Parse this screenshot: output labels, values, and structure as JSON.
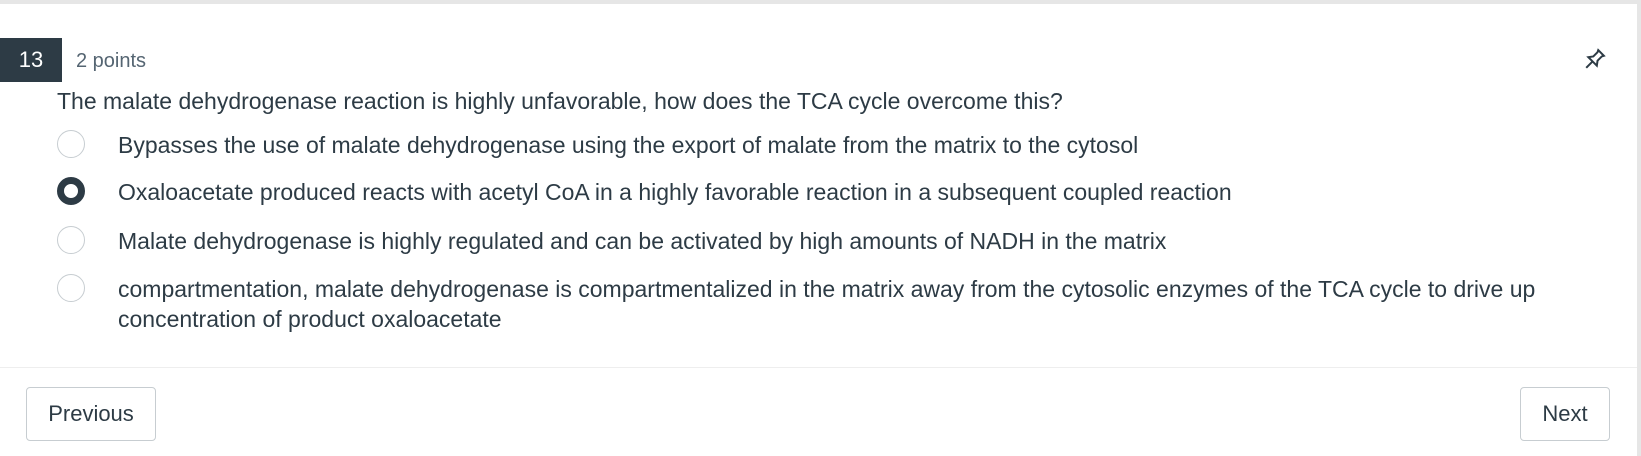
{
  "question": {
    "number": "13",
    "points": "2 points",
    "text": "The malate dehydrogenase reaction is highly unfavorable, how does the TCA cycle overcome this?",
    "pin_icon": "pin-icon",
    "answers": [
      {
        "label": "Bypasses the use of malate dehydrogenase using the export of malate from the matrix to the cytosol",
        "selected": false
      },
      {
        "label": "Oxaloacetate produced reacts with acetyl CoA in a highly favorable reaction in a subsequent coupled reaction",
        "selected": true
      },
      {
        "label": "Malate dehydrogenase is highly regulated and can be activated by high amounts of NADH in the matrix",
        "selected": false
      },
      {
        "label": "compartmentation, malate dehydrogenase is compartmentalized in the matrix away from the cytosolic enzymes of the TCA cycle to drive up concentration of product oxaloacetate",
        "selected": false
      }
    ]
  },
  "nav": {
    "previous_label": "Previous",
    "next_label": "Next"
  },
  "colors": {
    "badge_bg": "#2d3b45",
    "text": "#2d3b45",
    "border": "#c7cdd1"
  }
}
